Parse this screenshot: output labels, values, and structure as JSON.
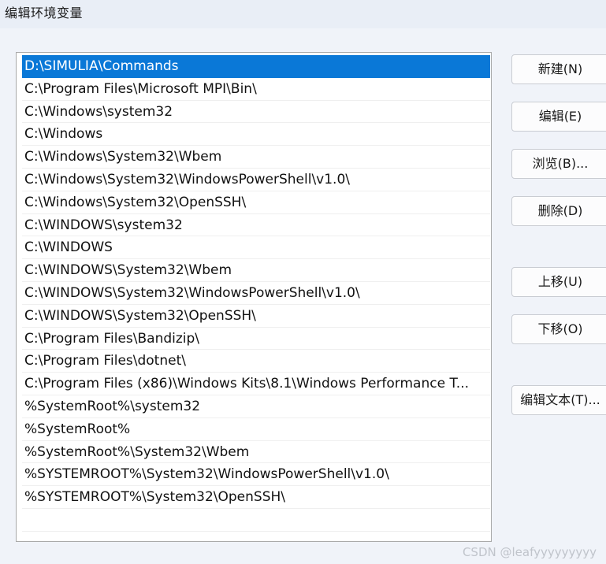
{
  "window": {
    "title": "编辑环境变量"
  },
  "path_list": {
    "items": [
      "D:\\SIMULIA\\Commands",
      "C:\\Program Files\\Microsoft MPI\\Bin\\",
      "C:\\Windows\\system32",
      "C:\\Windows",
      "C:\\Windows\\System32\\Wbem",
      "C:\\Windows\\System32\\WindowsPowerShell\\v1.0\\",
      "C:\\Windows\\System32\\OpenSSH\\",
      "C:\\WINDOWS\\system32",
      "C:\\WINDOWS",
      "C:\\WINDOWS\\System32\\Wbem",
      "C:\\WINDOWS\\System32\\WindowsPowerShell\\v1.0\\",
      "C:\\WINDOWS\\System32\\OpenSSH\\",
      "C:\\Program Files\\Bandizip\\",
      "C:\\Program Files\\dotnet\\",
      "C:\\Program Files (x86)\\Windows Kits\\8.1\\Windows Performance T...",
      "%SystemRoot%\\system32",
      "%SystemRoot%",
      "%SystemRoot%\\System32\\Wbem",
      "%SYSTEMROOT%\\System32\\WindowsPowerShell\\v1.0\\",
      "%SYSTEMROOT%\\System32\\OpenSSH\\",
      ""
    ],
    "selected_index": 0
  },
  "buttons": {
    "new": "新建(N)",
    "edit": "编辑(E)",
    "browse": "浏览(B)...",
    "delete": "删除(D)",
    "move_up": "上移(U)",
    "move_down": "下移(O)",
    "edit_text": "编辑文本(T)..."
  },
  "watermark": "CSDN @leafyyyyyyyyy",
  "colors": {
    "selection": "#0a78d7",
    "background": "#f0f3f9"
  }
}
